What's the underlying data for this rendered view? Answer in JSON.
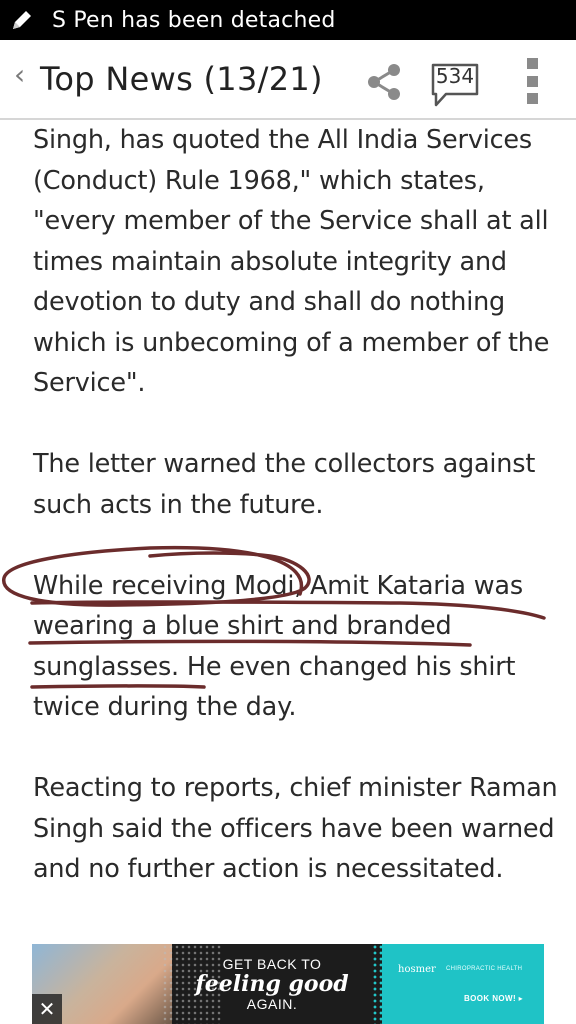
{
  "status_bar": {
    "message": "S Pen has been detached"
  },
  "app_bar": {
    "title": "Top News (13/21)",
    "comment_count": "534",
    "icons": [
      "back-chevron-icon",
      "share-icon",
      "comment-icon",
      "overflow-menu-icon"
    ]
  },
  "article": {
    "paragraphs": [
      "Singh, has quoted the All India Services (Conduct) Rule 1968,\" which states, \"every member of the Service shall at all times maintain absolute integrity and devotion to duty and shall do nothing which is unbecoming of a member of the Service\".",
      "The letter warned the collectors against such acts in the future.",
      "While receiving Modi, Amit Kataria was wearing a blue shirt and branded sunglasses. He even changed his shirt twice during the day.",
      "Reacting to reports, chief minister Raman Singh said the officers have been warned and no further action is necessitated."
    ]
  },
  "annotations": {
    "ink_color": "#6b2c2c"
  },
  "ad": {
    "line1": "GET BACK TO",
    "line2": "feeling good",
    "line3": "AGAIN.",
    "brand": "hosmer",
    "brand_subtitle": "CHIROPRACTIC HEALTH",
    "cta": "BOOK NOW! ▸",
    "close": "✕"
  }
}
